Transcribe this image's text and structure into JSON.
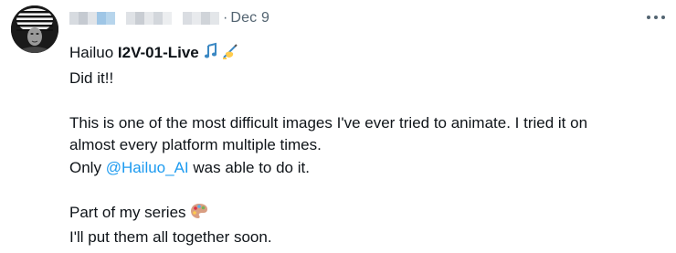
{
  "tweet": {
    "date": "Dec 9",
    "separator": "·",
    "line1_plain": "Hailuo ",
    "line1_bold": "I2V-01-Live",
    "line2": "Did it!!",
    "line3": "This is one of the most difficult images I've ever tried to animate. I tried it on",
    "line4": "almost every platform multiple times.",
    "line5_pre": "Only ",
    "mention": "@Hailuo_AI",
    "line5_post": " was able to do it.",
    "line6": "Part of my series",
    "line7": "I'll put them all together soon.",
    "icons": {
      "music_notes": "music-notes-icon",
      "writing_hand": "writing-hand-icon",
      "palette": "artist-palette-icon",
      "more": "more-options-icon"
    }
  },
  "colors": {
    "text": "#0f1419",
    "secondary": "#536471",
    "link": "#1d9bf0"
  }
}
